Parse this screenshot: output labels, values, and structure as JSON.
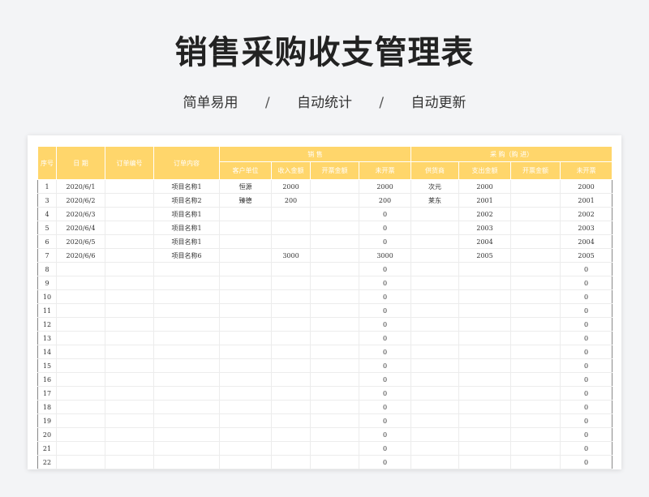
{
  "title": "销售采购收支管理表",
  "subtitle": {
    "items": [
      "简单易用",
      "自动统计",
      "自动更新"
    ],
    "separator": "/"
  },
  "table": {
    "headers": {
      "seq": "序号",
      "date": "日  期",
      "order_no": "订单编号",
      "order_content": "订单内容",
      "sales_group": "销    售",
      "purchase_group": "采    购（购 进）",
      "sales_cols": [
        "客户单位",
        "收入金额",
        "开票金额",
        "未开票"
      ],
      "purchase_cols": [
        "供货商",
        "支出金额",
        "开票金额",
        "未开票"
      ]
    },
    "rows": [
      [
        "1",
        "2020/6/1",
        "",
        "项目名称1",
        "恒源",
        "2000",
        "",
        "2000",
        "次元",
        "2000",
        "",
        "2000"
      ],
      [
        "3",
        "2020/6/2",
        "",
        "项目名称2",
        "臻德",
        "200",
        "",
        "200",
        "莱东",
        "2001",
        "",
        "2001"
      ],
      [
        "4",
        "2020/6/3",
        "",
        "项目名称1",
        "",
        "",
        "",
        "0",
        "",
        "2002",
        "",
        "2002"
      ],
      [
        "5",
        "2020/6/4",
        "",
        "项目名称1",
        "",
        "",
        "",
        "0",
        "",
        "2003",
        "",
        "2003"
      ],
      [
        "6",
        "2020/6/5",
        "",
        "项目名称1",
        "",
        "",
        "",
        "0",
        "",
        "2004",
        "",
        "2004"
      ],
      [
        "7",
        "2020/6/6",
        "",
        "项目名称6",
        "",
        "3000",
        "",
        "3000",
        "",
        "2005",
        "",
        "2005"
      ],
      [
        "8",
        "",
        "",
        "",
        "",
        "",
        "",
        "0",
        "",
        "",
        "",
        "0"
      ],
      [
        "9",
        "",
        "",
        "",
        "",
        "",
        "",
        "0",
        "",
        "",
        "",
        "0"
      ],
      [
        "10",
        "",
        "",
        "",
        "",
        "",
        "",
        "0",
        "",
        "",
        "",
        "0"
      ],
      [
        "11",
        "",
        "",
        "",
        "",
        "",
        "",
        "0",
        "",
        "",
        "",
        "0"
      ],
      [
        "12",
        "",
        "",
        "",
        "",
        "",
        "",
        "0",
        "",
        "",
        "",
        "0"
      ],
      [
        "13",
        "",
        "",
        "",
        "",
        "",
        "",
        "0",
        "",
        "",
        "",
        "0"
      ],
      [
        "14",
        "",
        "",
        "",
        "",
        "",
        "",
        "0",
        "",
        "",
        "",
        "0"
      ],
      [
        "15",
        "",
        "",
        "",
        "",
        "",
        "",
        "0",
        "",
        "",
        "",
        "0"
      ],
      [
        "16",
        "",
        "",
        "",
        "",
        "",
        "",
        "0",
        "",
        "",
        "",
        "0"
      ],
      [
        "17",
        "",
        "",
        "",
        "",
        "",
        "",
        "0",
        "",
        "",
        "",
        "0"
      ],
      [
        "18",
        "",
        "",
        "",
        "",
        "",
        "",
        "0",
        "",
        "",
        "",
        "0"
      ],
      [
        "19",
        "",
        "",
        "",
        "",
        "",
        "",
        "0",
        "",
        "",
        "",
        "0"
      ],
      [
        "20",
        "",
        "",
        "",
        "",
        "",
        "",
        "0",
        "",
        "",
        "",
        "0"
      ],
      [
        "21",
        "",
        "",
        "",
        "",
        "",
        "",
        "0",
        "",
        "",
        "",
        "0"
      ],
      [
        "22",
        "",
        "",
        "",
        "",
        "",
        "",
        "0",
        "",
        "",
        "",
        "0"
      ]
    ]
  },
  "colors": {
    "header_bg": "#ffd66b",
    "header_text": "#ffffff",
    "page_bg": "#f3f4f6"
  }
}
